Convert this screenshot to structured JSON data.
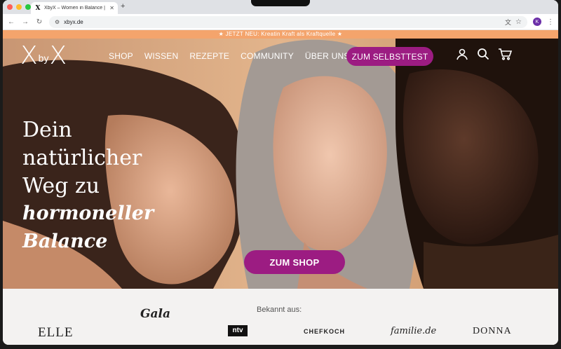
{
  "browser": {
    "tab_title": "XbyX – Women in Balance | H",
    "tab_favicon": "X",
    "url": "xbyx.de",
    "profile_initial": "K",
    "traffic_lights": [
      "#ff5f57",
      "#febc2e",
      "#28c840"
    ]
  },
  "announcement": "★ JETZT NEU: Kreatin Kraft als Kraftquelle ★",
  "header": {
    "logo_x1": "X",
    "logo_by": "by",
    "logo_x2": "X",
    "nav": [
      "SHOP",
      "WISSEN",
      "REZEPTE",
      "COMMUNITY",
      "ÜBER UNS"
    ],
    "cta": "ZUM SELBSTTEST"
  },
  "hero": {
    "line1": "Dein",
    "line2": "natürlicher",
    "line3": "Weg zu",
    "script1": "hormoneller",
    "script2": "Balance",
    "button": "ZUM SHOP"
  },
  "press": {
    "label": "Bekannt aus:",
    "logos": [
      "Gala",
      "ELLE",
      "ntv",
      "CHEFKOCH",
      "familie.de",
      "DONNA"
    ]
  },
  "colors": {
    "accent": "#9c1c82",
    "announce_bar": "#f4a46c",
    "press_bg": "#f3f2f1"
  }
}
